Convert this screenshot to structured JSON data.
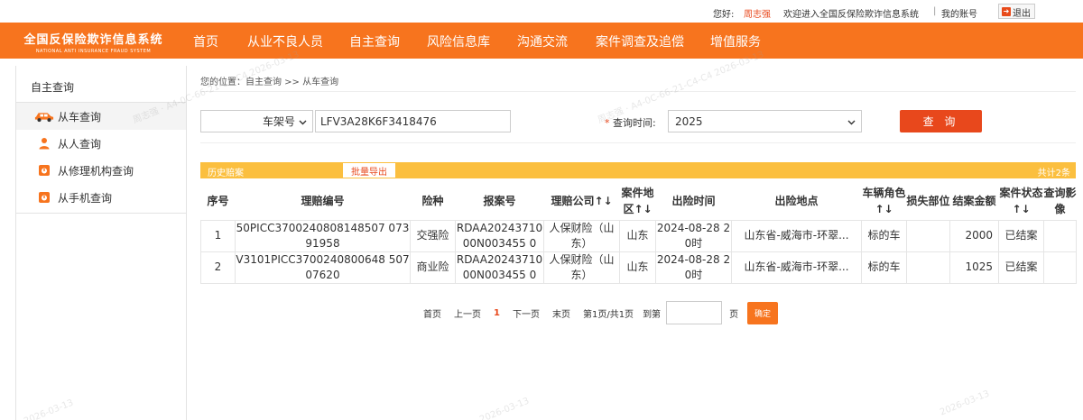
{
  "topbar": {
    "hello": "您好:",
    "user": "周志强",
    "welcome": "欢迎进入全国反保险欺诈信息系统",
    "separator": "|",
    "account": "我的账号",
    "logout": "退出"
  },
  "logo": {
    "title_cn": "全国反保险欺诈信息系统",
    "title_en": "NATIONAL ANTI INSURANCE FRAUD SYSTEM"
  },
  "nav": [
    "首页",
    "从业不良人员",
    "自主查询",
    "风险信息库",
    "沟通交流",
    "案件调查及追偿",
    "增值服务"
  ],
  "sidebar": {
    "title": "自主查询",
    "items": [
      {
        "label": "从车查询",
        "icon": "car-icon"
      },
      {
        "label": "从人查询",
        "icon": "person-icon"
      },
      {
        "label": "从修理机构查询",
        "icon": "repair-shop-icon"
      },
      {
        "label": "从手机查询",
        "icon": "phone-icon"
      }
    ]
  },
  "breadcrumb": "您的位置：自主查询 >> 从车查询",
  "search": {
    "type_selected": "车架号",
    "vin_value": "LFV3A28K6F3418476",
    "time_label": "查询时间:",
    "required_mark": "*",
    "year_selected": "2025",
    "query_button": "查 询"
  },
  "history": {
    "title": "历史赔案",
    "export_button": "批量导出",
    "count": "共计2条"
  },
  "table": {
    "headers": [
      "序号",
      "理赔编号",
      "险种",
      "报案号",
      "理赔公司↑↓",
      "案件地区↑↓",
      "出险时间",
      "出险地点",
      "车辆角色↑↓",
      "损失部位",
      "结案金额",
      "案件状态↑↓",
      "查询影像"
    ],
    "rows": [
      [
        "1",
        "50PICC3700240808148507 07391958",
        "交强险",
        "RDAA2024371000N003455 0",
        "人保财险（山东）",
        "山东",
        "2024-08-28 20时",
        "山东省-威海市-环翠...",
        "标的车",
        "",
        "2000",
        "已结案",
        ""
      ],
      [
        "2",
        "V3101PICC3700240800648 50707620",
        "商业险",
        "RDAA2024371000N003455 0",
        "人保财险（山东）",
        "山东",
        "2024-08-28 20时",
        "山东省-威海市-环翠...",
        "标的车",
        "",
        "1025",
        "已结案",
        ""
      ]
    ]
  },
  "pagination": {
    "first": "首页",
    "prev": "上一页",
    "current": "1",
    "next": "下一页",
    "last": "末页",
    "info": "第1页/共1页",
    "jump_label": "到第",
    "unit": "页",
    "ok": "确定"
  },
  "watermarks": [
    "周志强 · A4-0C-66-21-C4-C4  2026-03-13",
    "周志强 · A4-0C-66-21-C4-C4  2026-03-13",
    "2026-03-13",
    "2026-03-13",
    "2026-03-13"
  ],
  "colors": {
    "header_orange": "#f7741e",
    "button_red": "#e8481c",
    "history_bar": "#fbbf3f"
  }
}
